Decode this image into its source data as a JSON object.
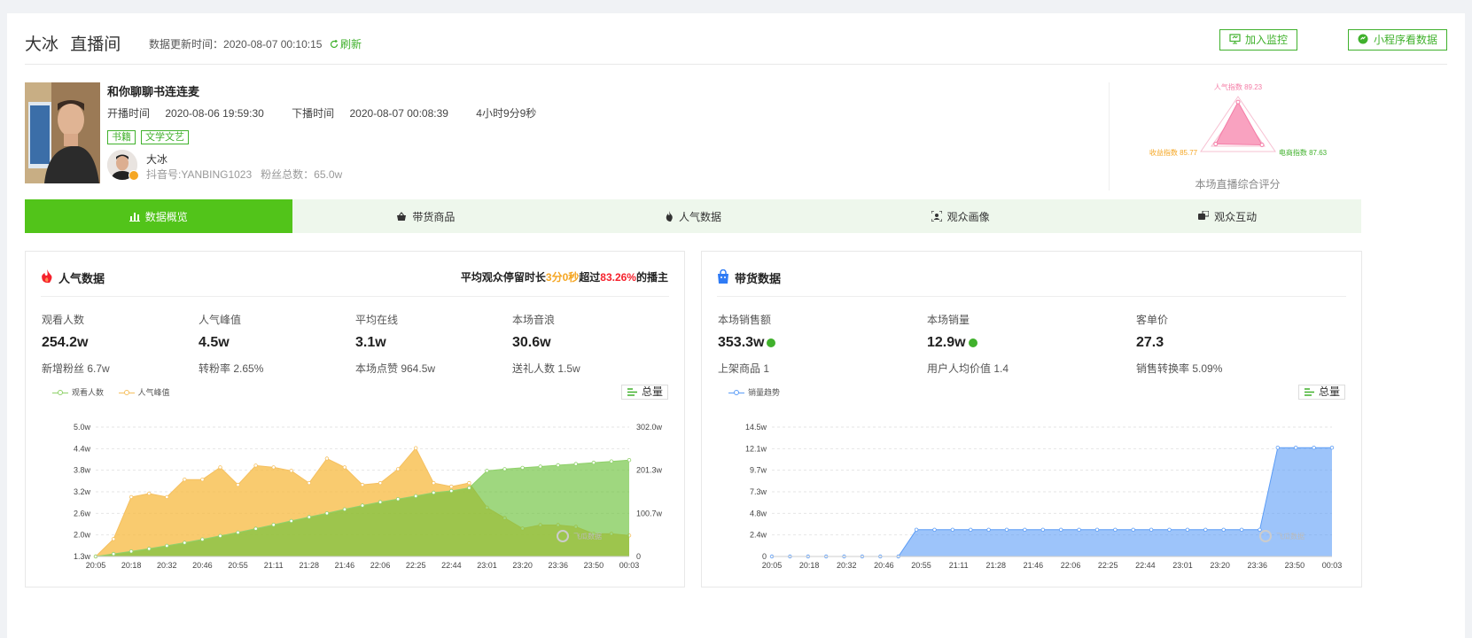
{
  "header": {
    "anchor_name": "大冰",
    "room_label": "直播间",
    "update_label": "数据更新时间：",
    "update_time": "2020-08-07 00:10:15",
    "refresh_label": "刷新",
    "monitor_button": "加入监控",
    "miniprogram_button": "小程序看数据"
  },
  "live": {
    "title": "和你聊聊书连连麦",
    "start_label": "开播时间",
    "start_time": "2020-08-06 19:59:30",
    "end_label": "下播时间",
    "end_time": "2020-08-07 00:08:39",
    "duration": "4小时9分9秒",
    "tags": [
      "书籍",
      "文学文艺"
    ],
    "anchor_name": "大冰",
    "douyin_id": "抖音号:YANBING1023",
    "fans": "粉丝总数：65.0w"
  },
  "radar": {
    "popularity": "人气指数 89.23",
    "revenue": "收益指数 85.77",
    "ecommerce": "电商指数 87.63",
    "caption": "本场直播综合评分",
    "values": {
      "popularity": 89.23,
      "revenue": 85.77,
      "ecommerce": 87.63
    }
  },
  "tabs": [
    {
      "label": "数据概览",
      "icon": "bar-chart-icon",
      "active": true
    },
    {
      "label": "带货商品",
      "icon": "basket-icon",
      "active": false
    },
    {
      "label": "人气数据",
      "icon": "fire-icon",
      "active": false
    },
    {
      "label": "观众画像",
      "icon": "portrait-icon",
      "active": false
    },
    {
      "label": "观众互动",
      "icon": "interaction-icon",
      "active": false
    }
  ],
  "popularity_card": {
    "title": "人气数据",
    "note_prefix": "平均观众停留时长",
    "note_duration": "3分0秒",
    "note_mid": "超过",
    "note_percent": "83.26%",
    "note_suffix": "的播主",
    "metrics": [
      {
        "label": "观看人数",
        "value": "254.2w",
        "sub": "新增粉丝 6.7w"
      },
      {
        "label": "人气峰值",
        "value": "4.5w",
        "sub": "转粉率 2.65%"
      },
      {
        "label": "平均在线",
        "value": "3.1w",
        "sub": "本场点赞 964.5w"
      },
      {
        "label": "本场音浪",
        "value": "30.6w",
        "sub": "送礼人数 1.5w"
      }
    ],
    "total_button": "总量"
  },
  "sales_card": {
    "title": "带货数据",
    "metrics": [
      {
        "label": "本场销售额",
        "value": "353.3w",
        "sub": "上架商品 1",
        "verified": true
      },
      {
        "label": "本场销量",
        "value": "12.9w",
        "sub": "用户人均价值 1.4",
        "verified": true
      },
      {
        "label": "客单价",
        "value": "27.3",
        "sub": "销售转换率 5.09%",
        "verified": false
      }
    ],
    "total_button": "总量"
  },
  "watermark": "飞瓜数据",
  "colors": {
    "accent": "#52c41a",
    "orange": "#f5a623",
    "red": "#f5222d",
    "blue": "#5b9cf6"
  },
  "chart_data": [
    {
      "type": "area",
      "categories": [
        "20:05",
        "20:18",
        "20:32",
        "20:46",
        "20:55",
        "21:11",
        "21:28",
        "21:46",
        "22:06",
        "22:25",
        "22:44",
        "23:01",
        "23:20",
        "23:36",
        "23:50",
        "00:03"
      ],
      "series": [
        {
          "name": "观看人数",
          "axis": "right",
          "color": "#8fd16a",
          "values": [
            0,
            6,
            12,
            18,
            25,
            32,
            40,
            48,
            56,
            65,
            74,
            83,
            92,
            101,
            110,
            119,
            127,
            134,
            141,
            149,
            153,
            160,
            200,
            204,
            207,
            210,
            213,
            216,
            219,
            222,
            225
          ]
        },
        {
          "name": "人气峰值",
          "axis": "left",
          "color": "#f5c060",
          "values": [
            1.3,
            1.8,
            3.0,
            3.1,
            3.0,
            3.5,
            3.5,
            3.85,
            3.35,
            3.9,
            3.85,
            3.75,
            3.4,
            4.1,
            3.85,
            3.35,
            3.4,
            3.8,
            4.4,
            3.4,
            3.3,
            3.4,
            2.7,
            2.4,
            2.1,
            2.2,
            2.2,
            2.15,
            1.95,
            1.95,
            1.9
          ]
        }
      ],
      "yleft_ticks": [
        "1.3w",
        "2.0w",
        "2.6w",
        "3.2w",
        "3.8w",
        "4.4w",
        "5.0w"
      ],
      "yleft_range": [
        1.3,
        5.0
      ],
      "yright_ticks": [
        "0",
        "100.7w",
        "201.3w",
        "302.0w"
      ],
      "yright_range": [
        0,
        302
      ],
      "grid": true
    },
    {
      "type": "area",
      "categories": [
        "20:05",
        "20:18",
        "20:32",
        "20:46",
        "20:55",
        "21:11",
        "21:28",
        "21:46",
        "22:06",
        "22:25",
        "22:44",
        "23:01",
        "23:20",
        "23:36",
        "23:50",
        "00:03"
      ],
      "series": [
        {
          "name": "销量趋势",
          "color": "#5b9cf6",
          "values": [
            0,
            0,
            0,
            0,
            0,
            0,
            0,
            0,
            3,
            3,
            3,
            3,
            3,
            3,
            3,
            3,
            3,
            3,
            3,
            3,
            3,
            3,
            3,
            3,
            3,
            3,
            3,
            3,
            12.2,
            12.2,
            12.2,
            12.2
          ]
        }
      ],
      "y_ticks": [
        "0",
        "2.4w",
        "4.8w",
        "7.3w",
        "9.7w",
        "12.1w",
        "14.5w"
      ],
      "y_range": [
        0,
        14.5
      ],
      "grid": true
    }
  ]
}
